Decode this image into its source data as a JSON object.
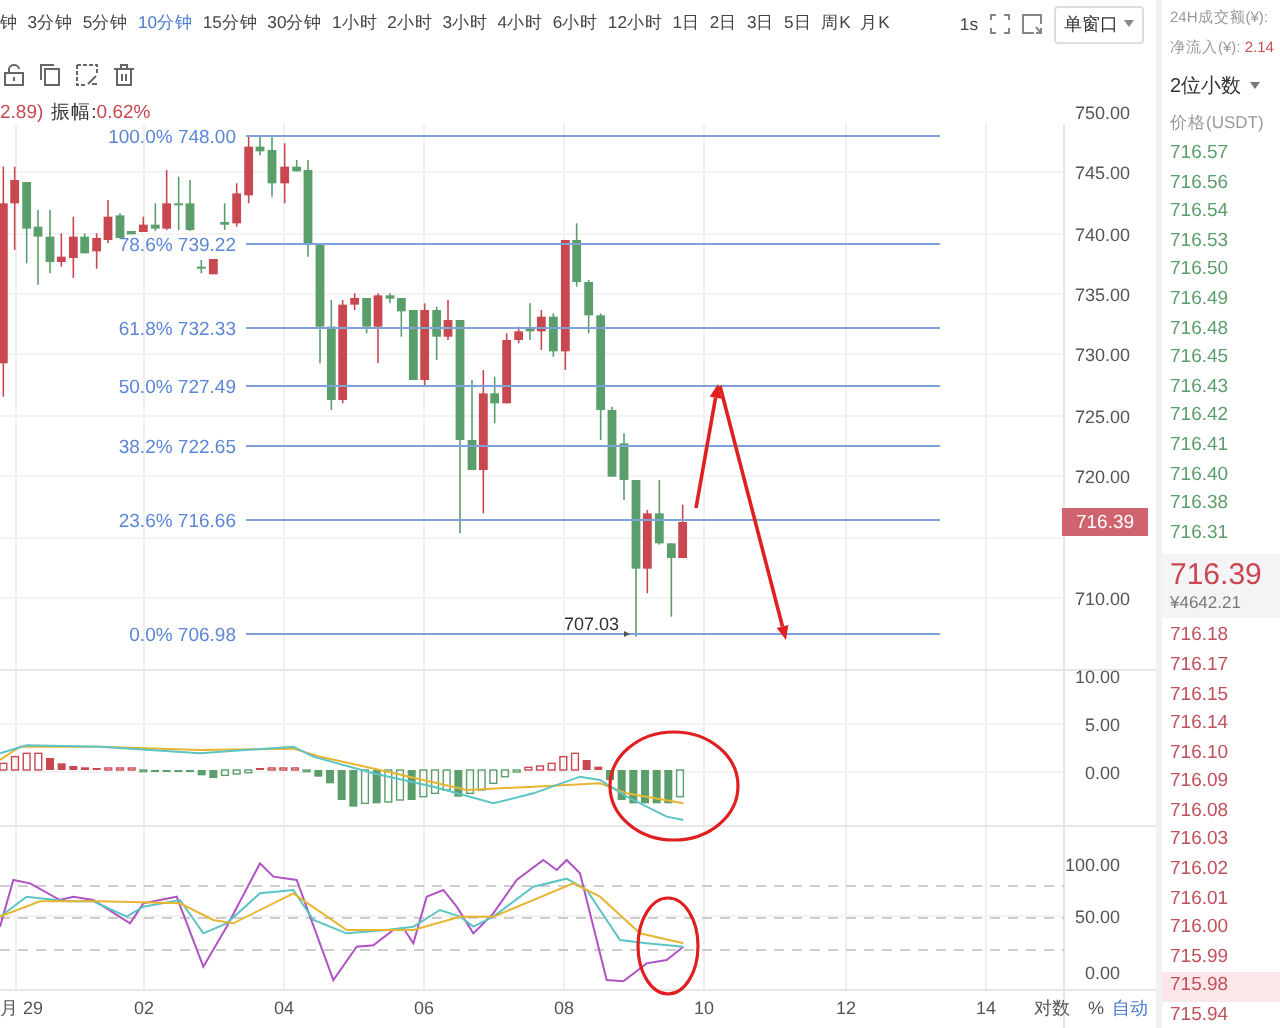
{
  "timeframe_bar": {
    "items": [
      {
        "label": "钟",
        "selected": false
      },
      {
        "label": "3分钟",
        "selected": false
      },
      {
        "label": "5分钟",
        "selected": false
      },
      {
        "label": "10分钟",
        "selected": true
      },
      {
        "label": "15分钟",
        "selected": false
      },
      {
        "label": "30分钟",
        "selected": false
      },
      {
        "label": "1小时",
        "selected": false
      },
      {
        "label": "2小时",
        "selected": false
      },
      {
        "label": "3小时",
        "selected": false
      },
      {
        "label": "4小时",
        "selected": false
      },
      {
        "label": "6小时",
        "selected": false
      },
      {
        "label": "12小时",
        "selected": false
      },
      {
        "label": "1日",
        "selected": false
      },
      {
        "label": "2日",
        "selected": false
      },
      {
        "label": "3日",
        "selected": false
      },
      {
        "label": "5日",
        "selected": false
      },
      {
        "label": "周K",
        "selected": false
      },
      {
        "label": "月K",
        "selected": false
      }
    ],
    "interval_button": "1s",
    "layout_dropdown": "单窗口"
  },
  "info_line": {
    "change_fragment": "2.89)",
    "amplitude_label": "振幅:",
    "amplitude_value": "0.62%"
  },
  "chart": {
    "fib_levels": [
      {
        "label": "100.0% 748.00"
      },
      {
        "label": "78.6% 739.22"
      },
      {
        "label": "61.8% 732.33"
      },
      {
        "label": "50.0% 727.49"
      },
      {
        "label": "38.2% 722.65"
      },
      {
        "label": "23.6% 716.66"
      },
      {
        "label": "0.0% 706.98"
      }
    ],
    "low_marker": "707.03",
    "current_price_tag": "716.39",
    "price_axis": [
      "750.00",
      "745.00",
      "740.00",
      "735.00",
      "730.00",
      "725.00",
      "720.00",
      "710.00"
    ],
    "macd_axis": [
      "10.00",
      "5.00",
      "0.00"
    ],
    "kdj_axis": [
      "100.00",
      "50.00",
      "0.00"
    ],
    "date_axis": [
      "月 29",
      "02",
      "04",
      "06",
      "08",
      "10",
      "12",
      "14"
    ],
    "axis_options": [
      {
        "label": "对数",
        "selected": false
      },
      {
        "label": "%",
        "selected": false
      },
      {
        "label": "自动",
        "selected": true
      }
    ]
  },
  "order_book": {
    "turnover_label": "24H成交额(¥):",
    "net_inflow_label": "净流入(¥):",
    "net_inflow_value": "2.14",
    "precision_dropdown": "2位小数",
    "price_header": "价格(USDT)",
    "asks": [
      "716.57",
      "716.56",
      "716.54",
      "716.53",
      "716.50",
      "716.49",
      "716.48",
      "716.45",
      "716.43",
      "716.42",
      "716.41",
      "716.40",
      "716.38",
      "716.31"
    ],
    "last_price": "716.39",
    "last_price_cny": "¥4642.21",
    "bids": [
      {
        "price": "716.18",
        "selected": false
      },
      {
        "price": "716.17",
        "selected": false
      },
      {
        "price": "716.15",
        "selected": false
      },
      {
        "price": "716.14",
        "selected": false
      },
      {
        "price": "716.10",
        "selected": false
      },
      {
        "price": "716.09",
        "selected": false
      },
      {
        "price": "716.08",
        "selected": false
      },
      {
        "price": "716.03",
        "selected": false
      },
      {
        "price": "716.02",
        "selected": false
      },
      {
        "price": "716.01",
        "selected": false
      },
      {
        "price": "716.00",
        "selected": false
      },
      {
        "price": "715.99",
        "selected": false
      },
      {
        "price": "715.98",
        "selected": true
      },
      {
        "price": "715.94",
        "selected": false
      }
    ]
  }
}
